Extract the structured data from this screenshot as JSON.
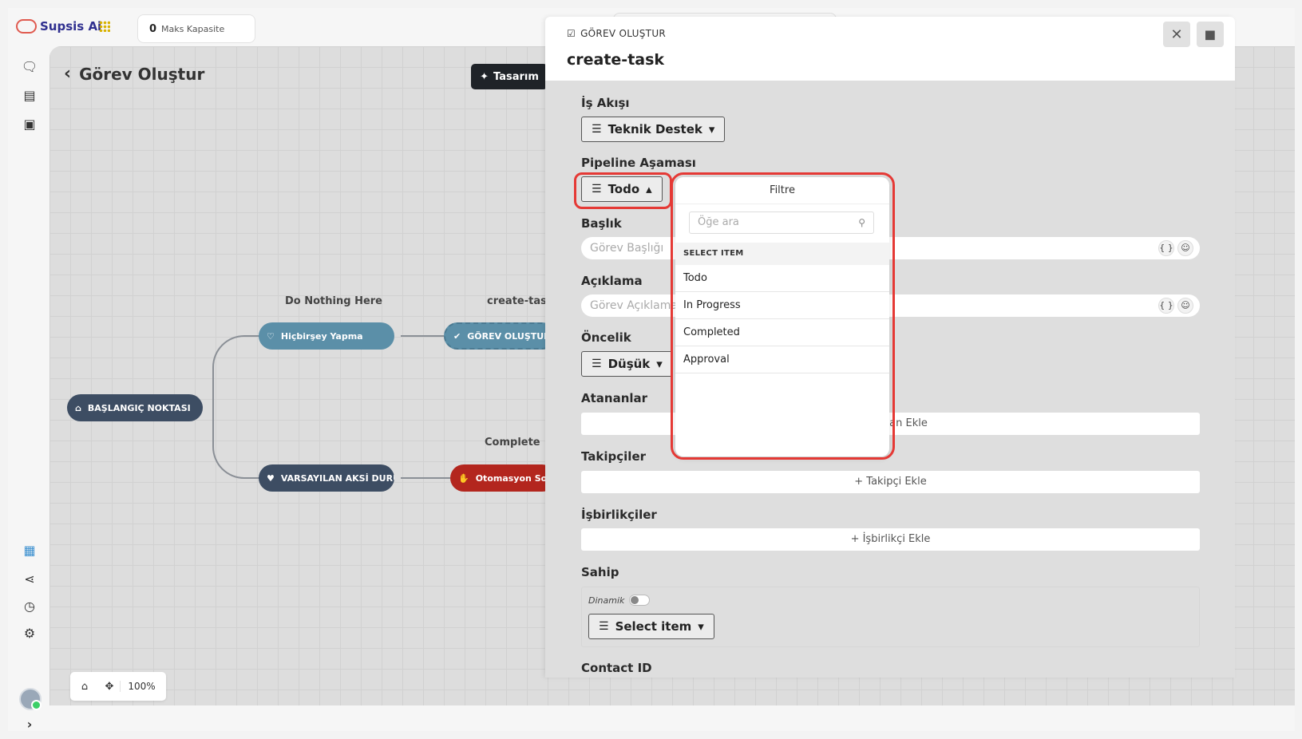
{
  "topbar": {
    "brand": "Supsis Ai",
    "capacity_count": "0",
    "capacity_label": "Maks Kapasite"
  },
  "canvas": {
    "page_title": "Görev Oluştur",
    "design_button": "Tasarım",
    "zoom_level": "100%",
    "nodes": {
      "start": "BAŞLANGIÇ NOKTASI",
      "do_nothing_caption": "Do Nothing Here",
      "do_nothing": "Hiçbirşey Yapma",
      "create_task_caption": "create-task",
      "create_task": "GÖREV OLUŞTUR",
      "default_caption": "Complete",
      "default_case": "VARSAYILAN AKSİ DURUM",
      "automation_end": "Otomasyon Sonl"
    }
  },
  "panel": {
    "kicker": "GÖREV OLUŞTUR",
    "title": "create-task",
    "fields": {
      "workflow_label": "İş Akışı",
      "workflow_value": "Teknik Destek",
      "stage_label": "Pipeline Aşaması",
      "stage_value": "Todo",
      "title_label": "Başlık",
      "title_placeholder": "Görev Başlığı",
      "description_label": "Açıklama",
      "description_placeholder": "Görev Açıklaması",
      "priority_label": "Öncelik",
      "priority_value": "Düşük",
      "assignees_label": "Atananlar",
      "assignees_add": "+ Atanan Ekle",
      "followers_label": "Takipçiler",
      "followers_add": "+ Takipçi Ekle",
      "collaborators_label": "İşbirlikçiler",
      "collaborators_add": "+ İşbirlikçi Ekle",
      "owner_label": "Sahip",
      "dynamic_label": "Dinamik",
      "owner_select": "Select item",
      "contact_label": "Contact ID"
    }
  },
  "dropdown": {
    "header": "Filtre",
    "search_placeholder": "Öğe ara",
    "section": "SELECT ITEM",
    "items": [
      "Todo",
      "In Progress",
      "Completed",
      "Approval"
    ]
  },
  "colors": {
    "highlight": "#e53935",
    "node_teal": "#5b8fa8",
    "node_dark": "#3d4d63",
    "node_red": "#b3261e"
  }
}
